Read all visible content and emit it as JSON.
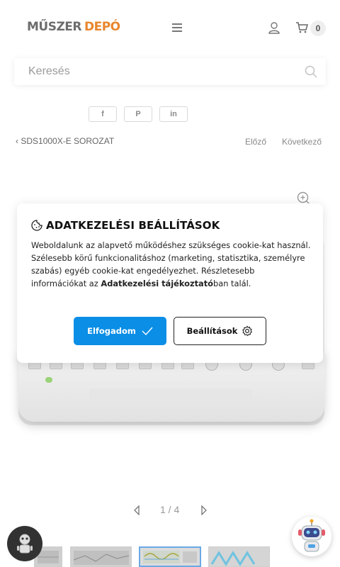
{
  "header": {
    "logo_part1": "MŰSZER",
    "logo_part2": "DEPÓ",
    "cart_count": "0"
  },
  "search": {
    "placeholder": "Keresés"
  },
  "share": {
    "facebook": "f",
    "pinterest": "P",
    "linkedin": "in"
  },
  "breadcrumb": {
    "arrow": "‹",
    "label": "SDS1000X-E SOROZAT"
  },
  "product_nav": {
    "prev_label": "Előző",
    "next_label": "Következő"
  },
  "cookie": {
    "title": "ADATKEZELÉSI BEÁLLÍTÁSOK",
    "text_main": "Weboldalunk az alapvető működéshez szükséges cookie-kat használ. Szélesebb körű funkcionalitáshoz (marketing, statisztika, személyre szabás) egyéb cookie-kat engedélyezhet. Részletesebb információkat az ",
    "text_link": "Adatkezelési tájékoztató",
    "text_end": "ban talál.",
    "accept_label": "Elfogadom",
    "settings_label": "Beállítások"
  },
  "pager": {
    "text": "1 / 4"
  },
  "colors": {
    "accent": "#0a8ee6",
    "logo_gray": "#6d6d6d",
    "logo_orange": "#e8862d"
  }
}
